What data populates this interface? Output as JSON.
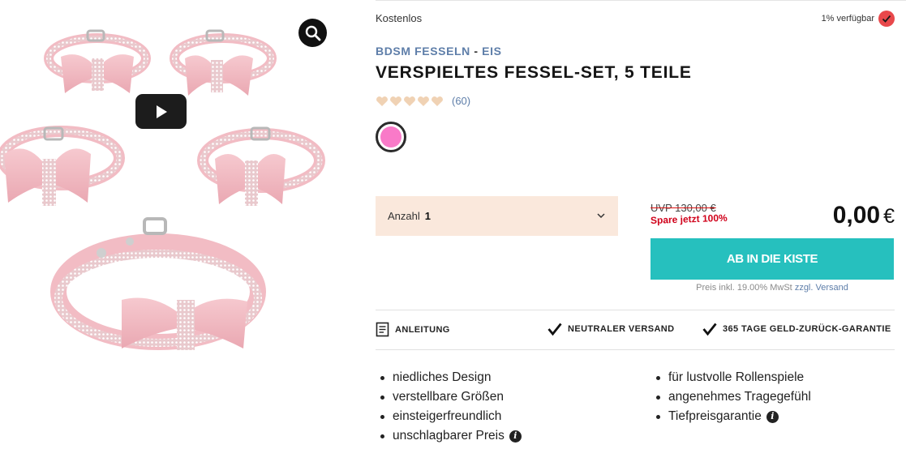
{
  "gallery": {
    "image_alt": "five pink rhinestone collars with bows",
    "zoom_icon": "magnifier-icon",
    "video_icon": "play-icon"
  },
  "price_free_label": "Kostenlos",
  "stock": {
    "text": "1% verfügbar",
    "icon": "check-icon",
    "color": "#e8484b"
  },
  "breadcrumb": {
    "category": "BDSM FESSELN",
    "separator": "-",
    "subcategory": "EIS"
  },
  "product": {
    "title": "VERSPIELTES FESSEL-SET, 5 TEILE"
  },
  "rating": {
    "stars": 5,
    "review_count": "(60)",
    "star_color": "#f0d2b4"
  },
  "color_swatch": {
    "color": "#f97ac8"
  },
  "quantity": {
    "label": "Anzahl",
    "value": "1"
  },
  "pricing": {
    "uvp": "UVP 130,00 €",
    "save_text": "Spare jetzt 100%",
    "price": "0,00",
    "currency": "€"
  },
  "cart_button": {
    "label": "AB IN DIE KISTE",
    "color": "#26c0be"
  },
  "tax_note": {
    "text": "Preis inkl. 19.00% MwSt",
    "shipping_link": "zzgl. Versand"
  },
  "features": [
    {
      "label": "ANLEITUNG",
      "icon": "document-icon"
    },
    {
      "label": "NEUTRALER VERSAND",
      "icon": "checkmark-icon"
    },
    {
      "label": "365 TAGE GELD-ZURÜCK-GARANTIE",
      "icon": "checkmark-icon"
    }
  ],
  "bullets_left": [
    "niedliches Design",
    "verstellbare Größen",
    "einsteigerfreundlich",
    "unschlagbarer Preis"
  ],
  "bullets_right": [
    "für lustvolle Rollenspiele",
    "angenehmes Tragegefühl",
    "Tiefpreisgarantie"
  ]
}
